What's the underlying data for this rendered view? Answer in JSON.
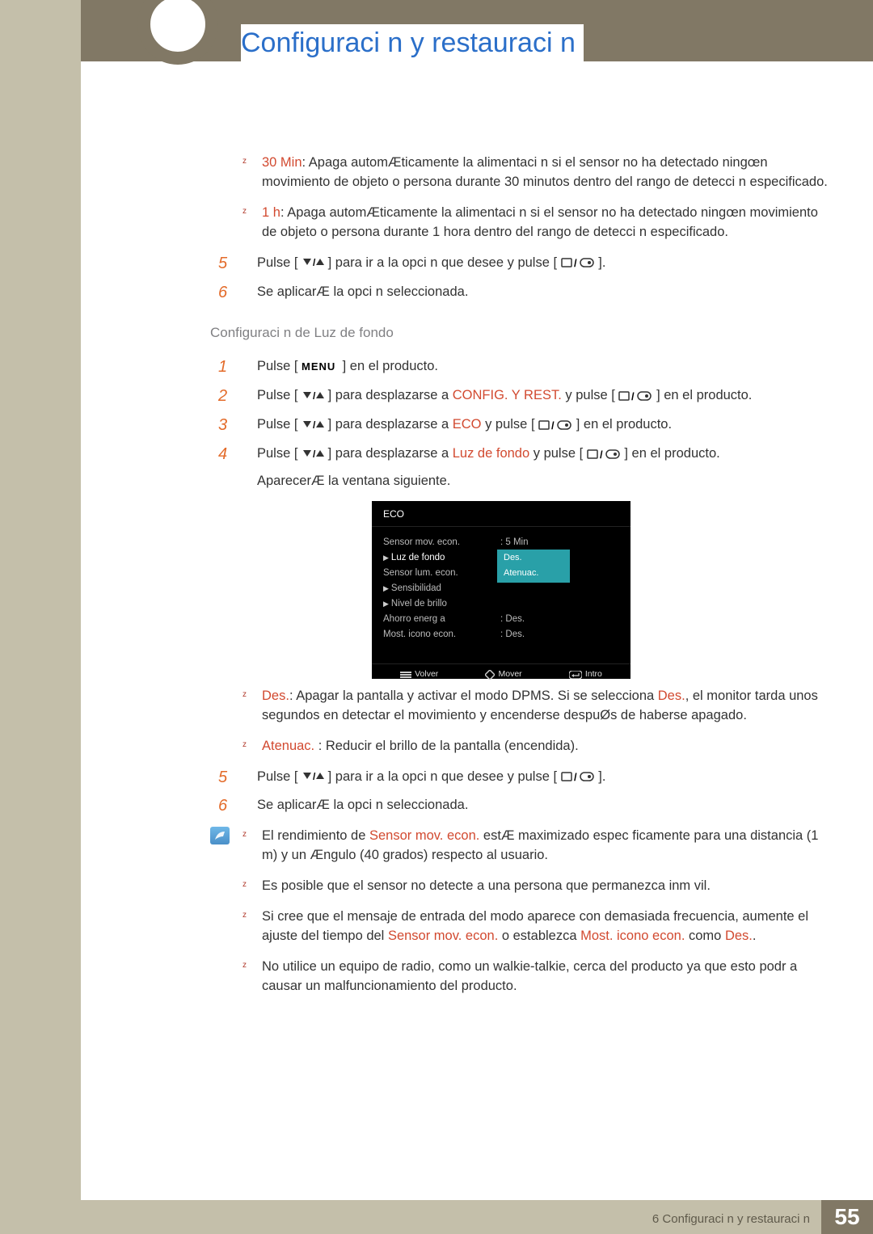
{
  "page_title": "Configuraci n y restauraci n",
  "top_bullets": [
    {
      "label": "30 Min",
      "rest": ": Apaga automÆticamente la alimentaci n si el sensor no ha detectado ningœn movimiento de objeto o persona durante 30 minutos dentro del rango de detecci n especificado."
    },
    {
      "label": "1 h",
      "rest": ": Apaga automÆticamente la alimentaci n si el sensor no ha detectado ningœn movimiento de objeto o persona durante 1 hora dentro del rango de detecci n especificado."
    }
  ],
  "step5": {
    "num": "5",
    "a": "Pulse [",
    "b": "] para ir a la opci n que desee y pulse [",
    "c": "]."
  },
  "step6": {
    "num": "6",
    "text": "Se aplicarÆ la opci n seleccionada."
  },
  "section_label": "Configuraci n de Luz de fondo",
  "s1": {
    "num": "1",
    "a": "Pulse [",
    "b": "] en el producto."
  },
  "s2": {
    "num": "2",
    "a": "Pulse [",
    "b": "] para desplazarse a ",
    "red": "CONFIG. Y REST.",
    "c": " y pulse [",
    "d": "] en el producto."
  },
  "s3": {
    "num": "3",
    "a": "Pulse [",
    "b": "] para desplazarse a ",
    "red": "ECO",
    "c": " y pulse [",
    "d": "] en el producto."
  },
  "s4": {
    "num": "4",
    "a": "Pulse [",
    "b": "] para desplazarse a ",
    "red": "Luz de fondo",
    "c": " y pulse [",
    "d": "] en el producto.",
    "e": "AparecerÆ la ventana siguiente."
  },
  "osd": {
    "title": "ECO",
    "rows": [
      {
        "left": "Sensor mov. econ.",
        "right": ":  5 Min",
        "sel": false,
        "tri": false
      },
      {
        "left": "Luz de fondo",
        "right": "Des.",
        "sel": true,
        "tri": true,
        "highlight": true,
        "sel_highlight": true
      },
      {
        "left": "Sensor lum. econ.",
        "right": "Atenuac.",
        "sel": false,
        "tri": false,
        "highlight": true
      },
      {
        "left": "Sensibilidad",
        "right": "",
        "sel": false,
        "tri": true
      },
      {
        "left": "Nivel de brillo",
        "right": "",
        "sel": false,
        "tri": true
      },
      {
        "left": "Ahorro energ a",
        "right": ":  Des.",
        "sel": false,
        "tri": false
      },
      {
        "left": "Most. icono econ.",
        "right": ":  Des.",
        "sel": false,
        "tri": false
      }
    ],
    "foot": {
      "back": "Volver",
      "move": "Mover",
      "enter": "Intro"
    }
  },
  "after_osd": [
    {
      "label": "Des.",
      "rest": ": Apagar la pantalla y activar el modo DPMS. Si se selecciona ",
      "red2": "Des.",
      "rest2": ", el monitor tarda unos segundos en detectar el movimiento y encenderse despuØs de haberse apagado."
    },
    {
      "label": "Atenuac.",
      "rest": " : Reducir el brillo de la pantalla (encendida)."
    }
  ],
  "step5b": {
    "num": "5",
    "a": "Pulse [",
    "b": "] para ir a la opci n que desee y pulse [",
    "c": "]."
  },
  "step6b": {
    "num": "6",
    "text": "Se aplicarÆ la opci n seleccionada."
  },
  "notes": [
    {
      "a": "El rendimiento de ",
      "red1": "Sensor mov. econ.",
      "b": " estÆ maximizado espec ficamente para una distancia (1 m) y un Ængulo (40 grados) respecto al usuario."
    },
    {
      "a": "Es posible que el sensor no detecte a una persona que permanezca inm vil."
    },
    {
      "a": "Si cree que el mensaje de entrada del modo aparece con demasiada frecuencia, aumente el ajuste del tiempo del ",
      "red1": "Sensor mov. econ.",
      "b": " o establezca ",
      "red2": "Most. icono econ.",
      "c": " como ",
      "red3": "Des.",
      "d": "."
    },
    {
      "a": "No utilice un equipo de radio, como un walkie-talkie, cerca del producto ya que esto podr a causar un malfuncionamiento del producto."
    }
  ],
  "footer": {
    "chapter": "6 Configuraci n y restauraci n",
    "page": "55"
  }
}
